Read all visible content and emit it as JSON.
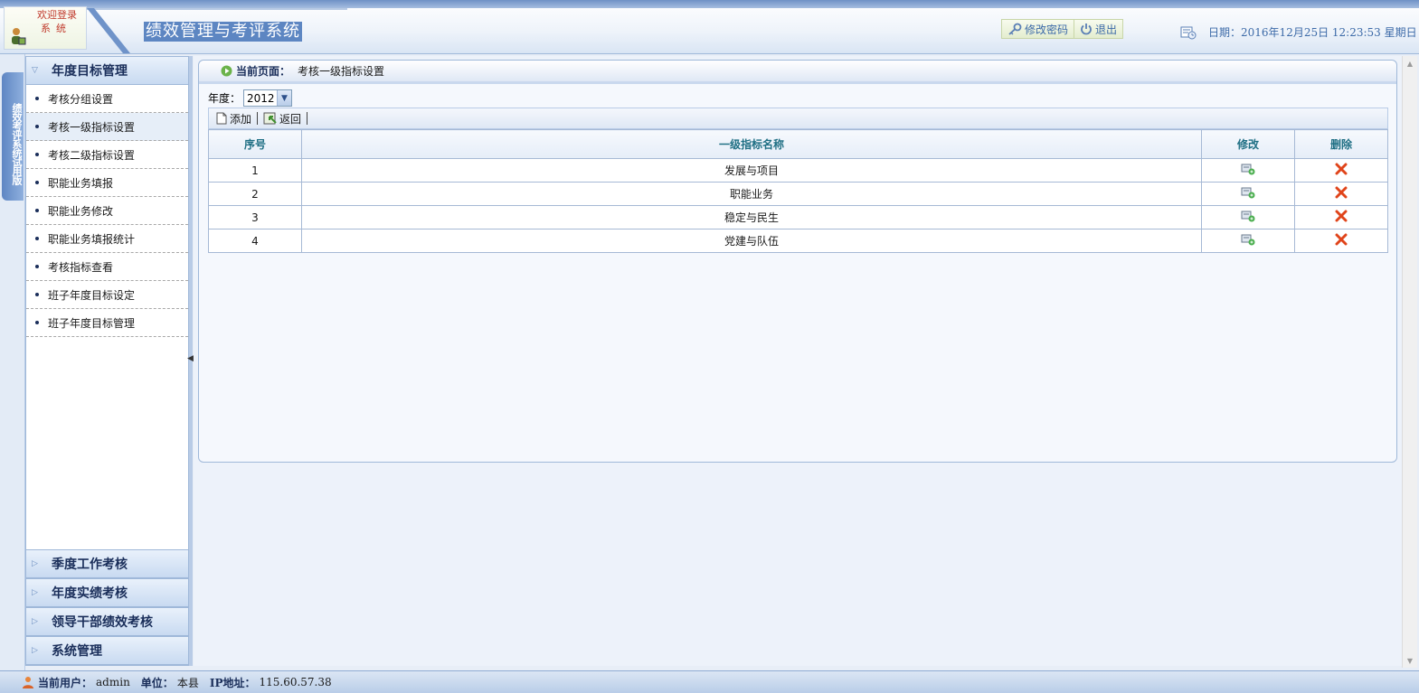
{
  "header": {
    "logo_line1": "欢迎登录",
    "logo_line2": "系统",
    "system_title": "绩效管理与考评系统",
    "change_password": "修改密码",
    "logout": "退出",
    "date_label": "日期：",
    "date_value": "2016年12月25日  12:23:53 星期日"
  },
  "vertical_tab": "绩效考评系统试用版",
  "sidebar": {
    "section_open": "年度目标管理",
    "items": [
      {
        "label": "考核分组设置"
      },
      {
        "label": "考核一级指标设置"
      },
      {
        "label": "考核二级指标设置"
      },
      {
        "label": "职能业务填报"
      },
      {
        "label": "职能业务修改"
      },
      {
        "label": "职能业务填报统计"
      },
      {
        "label": "考核指标查看"
      },
      {
        "label": "班子年度目标设定"
      },
      {
        "label": "班子年度目标管理"
      }
    ],
    "sections_closed": [
      {
        "label": "季度工作考核"
      },
      {
        "label": "年度实绩考核"
      },
      {
        "label": "领导干部绩效考核"
      },
      {
        "label": "系统管理"
      }
    ]
  },
  "breadcrumb": {
    "label": "当前页面：",
    "value": "考核一级指标设置"
  },
  "filter": {
    "year_label": "年度：",
    "year_value": "2012"
  },
  "toolbar": {
    "add_label": "添加",
    "back_label": "返回"
  },
  "table": {
    "headers": {
      "index": "序号",
      "name": "一级指标名称",
      "edit": "修改",
      "delete": "删除"
    },
    "rows": [
      {
        "index": "1",
        "name": "发展与项目"
      },
      {
        "index": "2",
        "name": "职能业务"
      },
      {
        "index": "3",
        "name": "稳定与民生"
      },
      {
        "index": "4",
        "name": "党建与队伍"
      }
    ]
  },
  "status_bar": {
    "user_label": "当前用户：",
    "user_value": "admin",
    "unit_label": "单位：",
    "unit_value": "本县",
    "ip_label": "IP地址：",
    "ip_value": "115.60.57.38"
  },
  "colors": {
    "accent": "#5d86c2",
    "header_text": "#3c6aa8",
    "table_header_text": "#1f6f84",
    "delete_icon": "#e0441a"
  }
}
